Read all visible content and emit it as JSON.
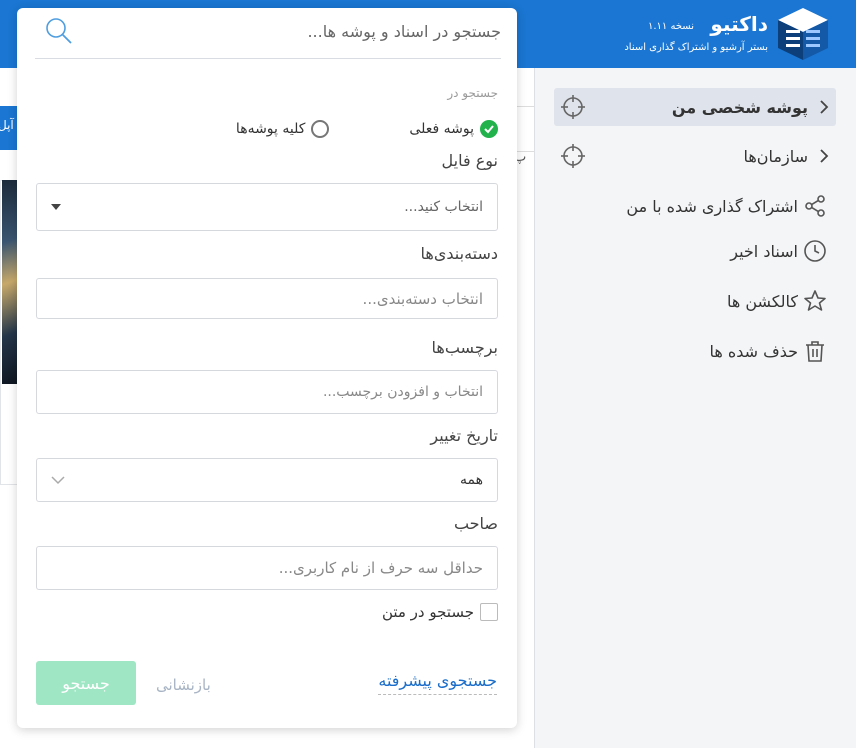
{
  "brand": {
    "name": "داکتیو",
    "version": "نسخه ۱.۱۱",
    "tagline": "بستر آرشیو و اشتراک گذاری اسناد"
  },
  "background": {
    "button_fragment": "آپل",
    "label_fragment": "پ"
  },
  "sidebar": {
    "items": [
      {
        "label": "پوشه شخصی من",
        "icon": "crosshair-icon",
        "active": true
      },
      {
        "label": "سازمان‌ها",
        "icon": "crosshair-icon",
        "active": false
      },
      {
        "label": "اشتراک گذاری شده با من",
        "icon": "share-icon",
        "active": false
      },
      {
        "label": "اسناد اخیر",
        "icon": "clock-icon",
        "active": false
      },
      {
        "label": "کالکشن ها",
        "icon": "star-icon",
        "active": false
      },
      {
        "label": "حذف شده ها",
        "icon": "trash-icon",
        "active": false
      }
    ]
  },
  "search_panel": {
    "placeholder": "جستجو در اسناد و پوشه ها...",
    "scope_label": "جستجو در",
    "scope_options": [
      "پوشه فعلی",
      "کلیه پوشه‌ها"
    ],
    "file_type_label": "نوع فایل",
    "file_type_value": "انتخاب کنید...",
    "categories_label": "دسته‌بندی‌ها",
    "categories_placeholder": "انتخاب دسته‌بندی...",
    "tags_label": "برچسب‌ها",
    "tags_placeholder": "انتخاب و افزودن برچسب...",
    "date_label": "تاریخ تغییر",
    "date_value": "همه",
    "owner_label": "صاحب",
    "owner_placeholder": "حداقل سه حرف از نام کاربری...",
    "fulltext_label": "جستجو در متن",
    "search_button": "جستجو",
    "reset_button": "بازنشانی",
    "advanced_link": "جستجوی پیشرفته"
  },
  "colors": {
    "brand": "#1a76d2",
    "search_button": "#9fe6c4",
    "radio_on": "#22b24c",
    "link": "#1a6dc9"
  }
}
